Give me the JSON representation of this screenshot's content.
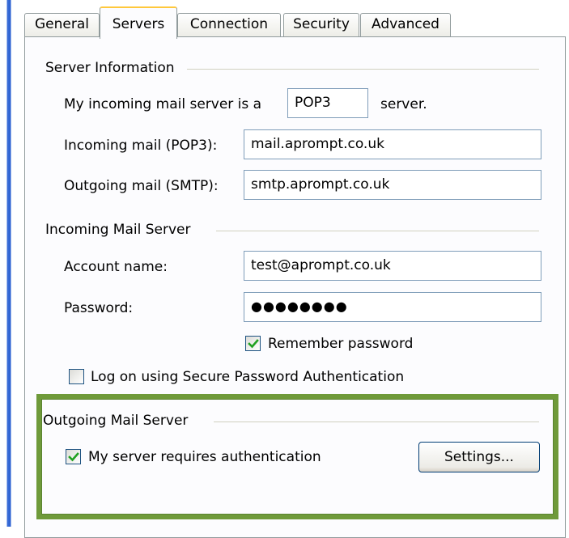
{
  "tabs": [
    {
      "label": "General",
      "active": false
    },
    {
      "label": "Servers",
      "active": true
    },
    {
      "label": "Connection",
      "active": false
    },
    {
      "label": "Security",
      "active": false
    },
    {
      "label": "Advanced",
      "active": false
    }
  ],
  "server_information": {
    "title": "Server Information",
    "incoming_type_prefix": "My incoming mail server is a",
    "incoming_type_value": "POP3",
    "incoming_type_suffix": "server.",
    "incoming_label": "Incoming mail (POP3):",
    "incoming_value": "mail.aprompt.co.uk",
    "outgoing_label": "Outgoing mail (SMTP):",
    "outgoing_value": "smtp.aprompt.co.uk"
  },
  "incoming_mail_server": {
    "title": "Incoming Mail Server",
    "account_label": "Account name:",
    "account_value": "test@aprompt.co.uk",
    "password_label": "Password:",
    "password_masked": "●●●●●●●●",
    "remember_password_label": "Remember password",
    "remember_password_checked": true,
    "spa_label": "Log on using Secure Password Authentication",
    "spa_checked": false
  },
  "outgoing_mail_server": {
    "title": "Outgoing Mail Server",
    "requires_auth_label": "My server requires authentication",
    "requires_auth_checked": true,
    "settings_button_label": "Settings..."
  },
  "colors": {
    "highlight_border": "#6f9a3a",
    "checkbox_check": "#21a121",
    "active_tab_accent": "#ffc83c"
  }
}
